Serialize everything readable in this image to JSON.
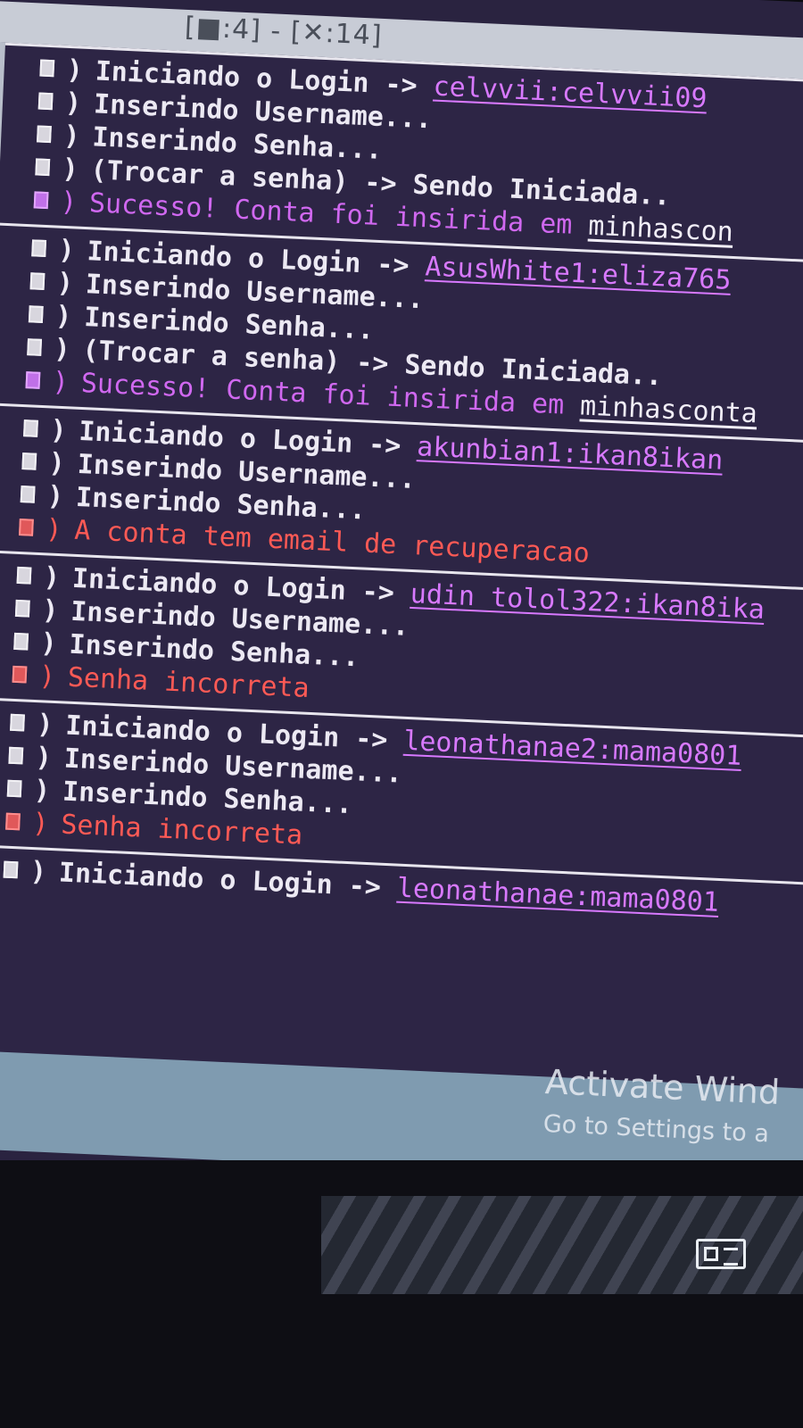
{
  "window": {
    "title": "[■:4] - [✕:14]"
  },
  "blocks": [
    {
      "lines": [
        {
          "text": "Iniciando o Login -> ",
          "cred": "celvvii:celvvii09",
          "status": "normal"
        },
        {
          "text": "Inserindo Username...",
          "status": "normal"
        },
        {
          "text": "Inserindo Senha...",
          "status": "normal"
        },
        {
          "text": "(Trocar a senha) -> Sendo Iniciada..",
          "status": "normal"
        },
        {
          "text": "Sucesso! Conta foi insirida em ",
          "link": "minhascon",
          "status": "success"
        }
      ]
    },
    {
      "lines": [
        {
          "text": "Iniciando o Login -> ",
          "cred": "AsusWhite1:eliza765",
          "status": "normal"
        },
        {
          "text": "Inserindo Username...",
          "status": "normal"
        },
        {
          "text": "Inserindo Senha...",
          "status": "normal"
        },
        {
          "text": "(Trocar a senha) -> Sendo Iniciada..",
          "status": "normal"
        },
        {
          "text": "Sucesso! Conta foi insirida em ",
          "link": "minhasconta",
          "status": "success"
        }
      ]
    },
    {
      "lines": [
        {
          "text": "Iniciando o Login -> ",
          "cred": "akunbian1:ikan8ikan",
          "status": "normal"
        },
        {
          "text": "Inserindo Username...",
          "status": "normal"
        },
        {
          "text": "Inserindo Senha...",
          "status": "normal"
        },
        {
          "text": "A conta tem email de recuperacao",
          "status": "error"
        }
      ]
    },
    {
      "lines": [
        {
          "text": "Iniciando o Login -> ",
          "cred": "udin tolol322:ikan8ika",
          "status": "normal"
        },
        {
          "text": "Inserindo Username...",
          "status": "normal"
        },
        {
          "text": "Inserindo Senha...",
          "status": "normal"
        },
        {
          "text": "Senha incorreta",
          "status": "error"
        }
      ]
    },
    {
      "lines": [
        {
          "text": "Iniciando o Login -> ",
          "cred": "leonathanae2:mama0801",
          "status": "normal"
        },
        {
          "text": "Inserindo Username...",
          "status": "normal"
        },
        {
          "text": "Inserindo Senha...",
          "status": "normal"
        },
        {
          "text": "Senha incorreta",
          "status": "error"
        }
      ]
    },
    {
      "lines": [
        {
          "text": "Iniciando o Login -> ",
          "cred": "leonathanae:mama0801",
          "status": "normal"
        }
      ]
    }
  ],
  "watermark": {
    "title": "Activate Wind",
    "subtitle": "Go to Settings to a"
  },
  "taskbar": {
    "icon": "news-widget-icon"
  },
  "colors": {
    "console_bg": "#2d2545",
    "credential": "#d879ff",
    "success": "#d068f0",
    "error": "#ff5a55"
  }
}
